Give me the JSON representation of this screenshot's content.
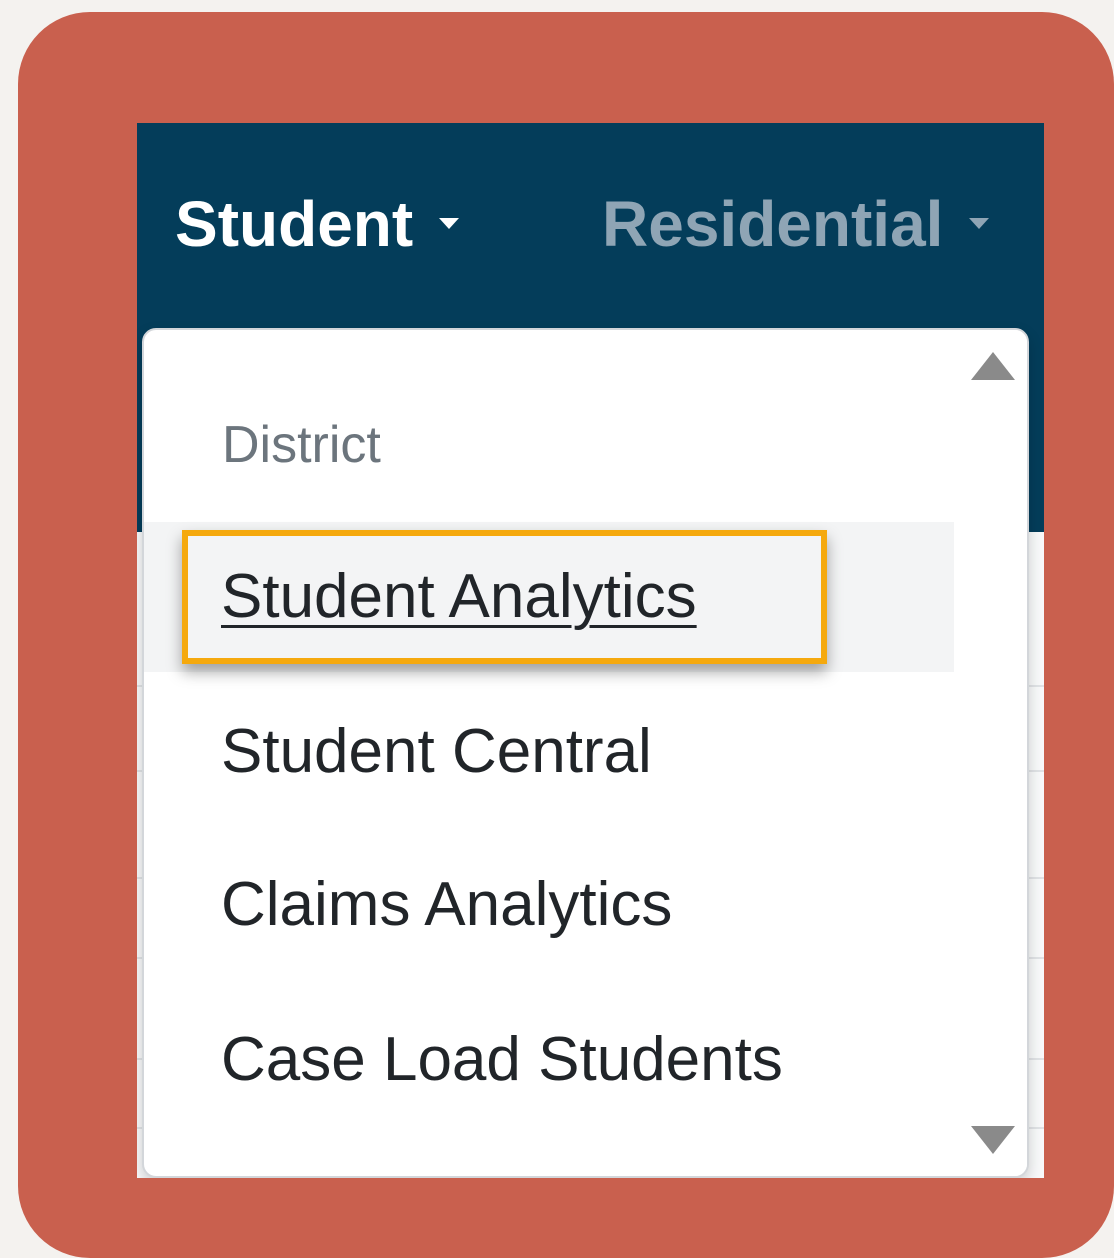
{
  "navbar": {
    "items": [
      {
        "label": "Student",
        "active": true
      },
      {
        "label": "Residential",
        "active": false
      }
    ],
    "background": "#043d5a"
  },
  "dropdown": {
    "header": "District",
    "items": [
      {
        "label": "Student Analytics",
        "highlighted": true
      },
      {
        "label": "Student Central"
      },
      {
        "label": "Claims Analytics"
      },
      {
        "label": "Case Load Students"
      }
    ],
    "highlight_color": "#f5a90e"
  },
  "frame_color": "#c9604e"
}
